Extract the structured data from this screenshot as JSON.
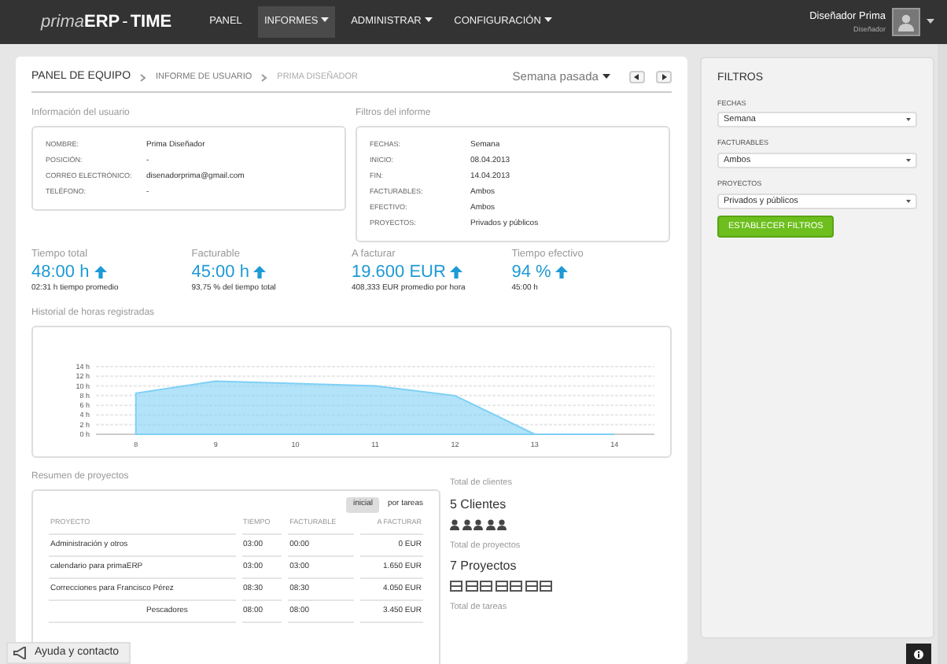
{
  "navbar": {
    "brand_light": "prima",
    "brand_bold": "ERP",
    "brand_sep": "-",
    "brand_app": "TIME",
    "menu": [
      {
        "label": "PANEL",
        "dropdown": false,
        "selected": false
      },
      {
        "label": "INFORMES",
        "dropdown": true,
        "selected": true
      },
      {
        "label": "ADMINISTRAR",
        "dropdown": true,
        "selected": false
      },
      {
        "label": "CONFIGURACIÓN",
        "dropdown": true,
        "selected": false
      }
    ],
    "user": {
      "name": "Diseñador Prima",
      "role": "Diseñador"
    }
  },
  "breadcrumb": [
    {
      "label": "PANEL DE EQUIPO",
      "kind": "root"
    },
    {
      "label": "INFORME DE USUARIO",
      "kind": "link"
    },
    {
      "label": "PRIMA DISEÑADOR",
      "kind": "current"
    }
  ],
  "period": {
    "label": "Semana pasada"
  },
  "user_info": {
    "title": "Información del usuario",
    "rows": [
      {
        "label": "NOMBRE:",
        "value": "Prima Diseñador"
      },
      {
        "label": "POSICIÓN:",
        "value": "-"
      },
      {
        "label": "CORREO ELECTRÓNICO:",
        "value": "disenadorprima@gmail.com"
      },
      {
        "label": "TELÉFONO:",
        "value": "-"
      }
    ]
  },
  "report_filters": {
    "title": "Filtros del informe",
    "rows": [
      {
        "label": "FECHAS:",
        "value": "Semana"
      },
      {
        "label": "INICIO:",
        "value": "08.04.2013"
      },
      {
        "label": "FIN:",
        "value": "14.04.2013"
      },
      {
        "label": "FACTURABLES:",
        "value": "Ambos"
      },
      {
        "label": "EFECTIVO:",
        "value": "Ambos"
      },
      {
        "label": "PROYECTOS:",
        "value": "Privados y públicos"
      }
    ]
  },
  "stats": [
    {
      "title": "Tiempo total",
      "value": "48:00 h",
      "note": "02:31 h tiempo promedio"
    },
    {
      "title": "Facturable",
      "value": "45:00 h",
      "note": "93,75 % del tiempo total"
    },
    {
      "title": "A facturar",
      "value": "19.600 EUR",
      "note": "408,333 EUR promedio por hora"
    },
    {
      "title": "Tiempo efectivo",
      "value": "94 %",
      "note": "45:00 h"
    }
  ],
  "history": {
    "title": "Historial de horas registradas",
    "chart_data": {
      "type": "area",
      "x": [
        8,
        9,
        10,
        11,
        12,
        13,
        14
      ],
      "series": [
        {
          "color": "#7fd0f5",
          "values": [
            8.5,
            11,
            10.5,
            10,
            8,
            0,
            0
          ]
        }
      ],
      "grid": true,
      "xlim": [
        7.5,
        14.5
      ],
      "xticks": [
        8,
        9,
        10,
        11,
        12,
        13,
        14
      ],
      "ylim": [
        0,
        14
      ],
      "yticks": [
        {
          "value": 0,
          "label": "0 h"
        },
        {
          "value": 2,
          "label": "2 h"
        },
        {
          "value": 4,
          "label": "4 h"
        },
        {
          "value": 6,
          "label": "6 h"
        },
        {
          "value": 8,
          "label": "8 h"
        },
        {
          "value": 10,
          "label": "10 h"
        },
        {
          "value": 12,
          "label": "12 h"
        },
        {
          "value": 14,
          "label": "14 h"
        }
      ]
    }
  },
  "projects": {
    "title": "Resumen de proyectos",
    "toggles": [
      {
        "label": "inicial",
        "selected": true
      },
      {
        "label": "por tareas",
        "selected": false
      }
    ],
    "columns": [
      "PROYECTO",
      "TIEMPO",
      "FACTURABLE",
      "A FACTURAR"
    ],
    "rows": [
      {
        "name": "Administración y otros",
        "time": "03:00",
        "billable": "00:00",
        "amount": "0 EUR",
        "covered": false
      },
      {
        "name": "calendario para primaERP",
        "time": "03:00",
        "billable": "03:00",
        "amount": "1.650 EUR",
        "covered": false
      },
      {
        "name": "Correcciones para Francisco Pérez",
        "time": "08:30",
        "billable": "08:30",
        "amount": "4.050 EUR",
        "covered": false
      },
      {
        "name": "Pescadores",
        "time": "08:00",
        "billable": "08:00",
        "amount": "3.450 EUR",
        "covered": true
      }
    ]
  },
  "totals": [
    {
      "title": "Total de clientes",
      "value": "5 Clientes",
      "kind": "person"
    },
    {
      "title": "Total de proyectos",
      "value": "7 Proyectos",
      "kind": "folder"
    },
    {
      "title": "Total de tareas",
      "kind": "none"
    }
  ],
  "filters": {
    "title": "FILTROS",
    "fields": [
      {
        "label": "FECHAS",
        "value": "Semana"
      },
      {
        "label": "FACTURABLES",
        "value": "Ambos"
      },
      {
        "label": "PROYECTOS",
        "value": "Privados y públicos"
      }
    ],
    "button": "ESTABLECER FILTROS"
  },
  "help": {
    "label": "Ayuda y contacto"
  }
}
